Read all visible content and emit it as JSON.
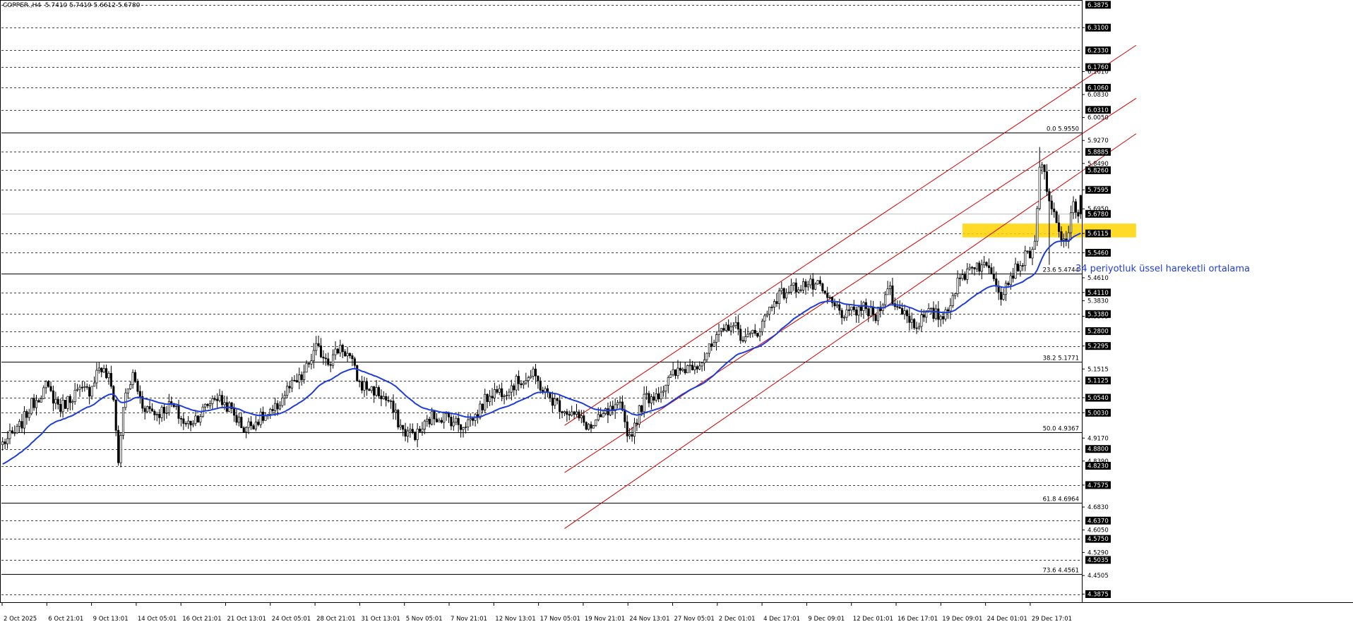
{
  "symbol_info": {
    "text": "COPPER.,H4  5.7410 5.7419 5.6612 5.6780"
  },
  "annotation": {
    "ema_text": "34 periyotluk üssel hareketli ortalama"
  },
  "colors": {
    "background": "#ffffff",
    "candle": "#000000",
    "ema": "#1f3ddb",
    "channel": "#d40000",
    "fib_line": "#000000",
    "highlight_zone": "#ffd400",
    "annotation": "#1f3ddb",
    "dashed_grid": "#000000"
  },
  "chart_data": {
    "type": "candlestick",
    "symbol": "COPPER.",
    "timeframe": "H4",
    "ohlc_current": {
      "open": 5.741,
      "high": 5.7419,
      "low": 5.6612,
      "close": 5.678
    },
    "y_range": [
      4.36,
      6.399
    ],
    "x_range": [
      "2 Oct 2025",
      "31 Dec 2025"
    ],
    "grid": "dashed horizontal levels",
    "price_ticks": [
      "6.3100",
      "6.1610",
      "6.0830",
      "6.0050",
      "5.9270",
      "5.8490",
      "5.7595",
      "5.6950",
      "5.6115",
      "5.5460",
      "5.4610",
      "5.4110",
      "5.3830",
      "5.3305",
      "5.2295",
      "5.1515",
      "5.0540",
      "5.0030",
      "4.9170",
      "4.8390",
      "4.7575",
      "4.6830",
      "4.6050",
      "4.5290",
      "4.4505",
      "4.3875"
    ],
    "highlighted_price_labels": [
      "6.3875",
      "6.3100",
      "6.2330",
      "6.1760",
      "6.1060",
      "6.0310",
      "5.8885",
      "5.8260",
      "5.7595",
      "5.6780",
      "5.6115",
      "5.5460",
      "5.4110",
      "5.3380",
      "5.2800",
      "5.2295",
      "5.1125",
      "5.0540",
      "5.0030",
      "4.8800",
      "4.8230",
      "4.7575",
      "4.6370",
      "4.5750",
      "4.5035",
      "4.3875"
    ],
    "dashed_levels": [
      6.3875,
      6.31,
      6.233,
      6.176,
      6.106,
      6.031,
      5.955,
      5.8885,
      5.826,
      5.7595,
      5.6115,
      5.546,
      5.411,
      5.338,
      5.28,
      5.2295,
      5.1125,
      5.054,
      5.003,
      4.88,
      4.823,
      4.7575,
      4.637,
      4.575,
      4.5035,
      4.3875
    ],
    "fib_levels": [
      {
        "label": "0.0 5.9550",
        "value": 5.955
      },
      {
        "label": "23.6 5.4744",
        "value": 5.4744
      },
      {
        "label": "38.2 5.1771",
        "value": 5.1771
      },
      {
        "label": "50.0 4.9367",
        "value": 4.9367
      },
      {
        "label": "61.8 4.6964",
        "value": 4.6964
      },
      {
        "label": "73.6 4.4561",
        "value": 4.4561
      }
    ],
    "current_price_line": 5.678,
    "x_labels": [
      "2 Oct 2025",
      "6 Oct 21:01",
      "9 Oct 13:01",
      "14 Oct 05:01",
      "16 Oct 21:01",
      "21 Oct 13:01",
      "24 Oct 05:01",
      "28 Oct 21:01",
      "31 Oct 13:01",
      "5 Nov 05:01",
      "7 Nov 21:01",
      "12 Nov 13:01",
      "17 Nov 05:01",
      "19 Nov 21:01",
      "24 Nov 13:01",
      "27 Nov 05:01",
      "2 Dec 01:01",
      "4 Dec 17:01",
      "9 Dec 09:01",
      "12 Dec 01:01",
      "16 Dec 17:01",
      "19 Dec 09:01",
      "24 Dec 01:01",
      "29 Dec 17:01"
    ],
    "close_path": [
      [
        0,
        4.9
      ],
      [
        6,
        4.94
      ],
      [
        12,
        5.03
      ],
      [
        18,
        5.09
      ],
      [
        24,
        5.02
      ],
      [
        30,
        5.07
      ],
      [
        36,
        5.08
      ],
      [
        40,
        5.16
      ],
      [
        44,
        5.12
      ],
      [
        46,
        5.06
      ],
      [
        48,
        4.83
      ],
      [
        50,
        5.03
      ],
      [
        54,
        5.13
      ],
      [
        58,
        5.03
      ],
      [
        64,
        5.0
      ],
      [
        70,
        5.03
      ],
      [
        76,
        4.96
      ],
      [
        82,
        5.0
      ],
      [
        88,
        5.06
      ],
      [
        94,
        5.02
      ],
      [
        100,
        4.95
      ],
      [
        106,
        4.98
      ],
      [
        112,
        5.0
      ],
      [
        118,
        5.08
      ],
      [
        124,
        5.12
      ],
      [
        130,
        5.22
      ],
      [
        136,
        5.18
      ],
      [
        140,
        5.23
      ],
      [
        144,
        5.19
      ],
      [
        148,
        5.1
      ],
      [
        154,
        5.08
      ],
      [
        160,
        5.04
      ],
      [
        166,
        4.94
      ],
      [
        172,
        4.93
      ],
      [
        178,
        4.99
      ],
      [
        184,
        4.99
      ],
      [
        190,
        4.96
      ],
      [
        196,
        4.99
      ],
      [
        202,
        5.07
      ],
      [
        208,
        5.08
      ],
      [
        214,
        5.11
      ],
      [
        220,
        5.13
      ],
      [
        226,
        5.06
      ],
      [
        232,
        5.02
      ],
      [
        238,
        4.99
      ],
      [
        244,
        4.95
      ],
      [
        250,
        5.0
      ],
      [
        256,
        5.02
      ],
      [
        260,
        4.92
      ],
      [
        266,
        5.05
      ],
      [
        272,
        5.07
      ],
      [
        278,
        5.13
      ],
      [
        284,
        5.16
      ],
      [
        290,
        5.18
      ],
      [
        296,
        5.25
      ],
      [
        302,
        5.31
      ],
      [
        308,
        5.25
      ],
      [
        314,
        5.29
      ],
      [
        320,
        5.39
      ],
      [
        326,
        5.42
      ],
      [
        332,
        5.44
      ],
      [
        338,
        5.43
      ],
      [
        344,
        5.37
      ],
      [
        350,
        5.33
      ],
      [
        356,
        5.36
      ],
      [
        362,
        5.33
      ],
      [
        366,
        5.41
      ],
      [
        368,
        5.42
      ],
      [
        370,
        5.36
      ],
      [
        374,
        5.35
      ],
      [
        378,
        5.3
      ],
      [
        384,
        5.34
      ],
      [
        390,
        5.33
      ],
      [
        396,
        5.44
      ],
      [
        402,
        5.51
      ],
      [
        406,
        5.5
      ],
      [
        410,
        5.49
      ],
      [
        414,
        5.41
      ],
      [
        418,
        5.47
      ],
      [
        422,
        5.51
      ],
      [
        428,
        5.57
      ],
      [
        430,
        5.85
      ],
      [
        432,
        5.8
      ],
      [
        434,
        5.71
      ],
      [
        436,
        5.67
      ],
      [
        438,
        5.61
      ],
      [
        440,
        5.58
      ],
      [
        442,
        5.62
      ],
      [
        444,
        5.7
      ],
      [
        447,
        5.678
      ]
    ]
  }
}
